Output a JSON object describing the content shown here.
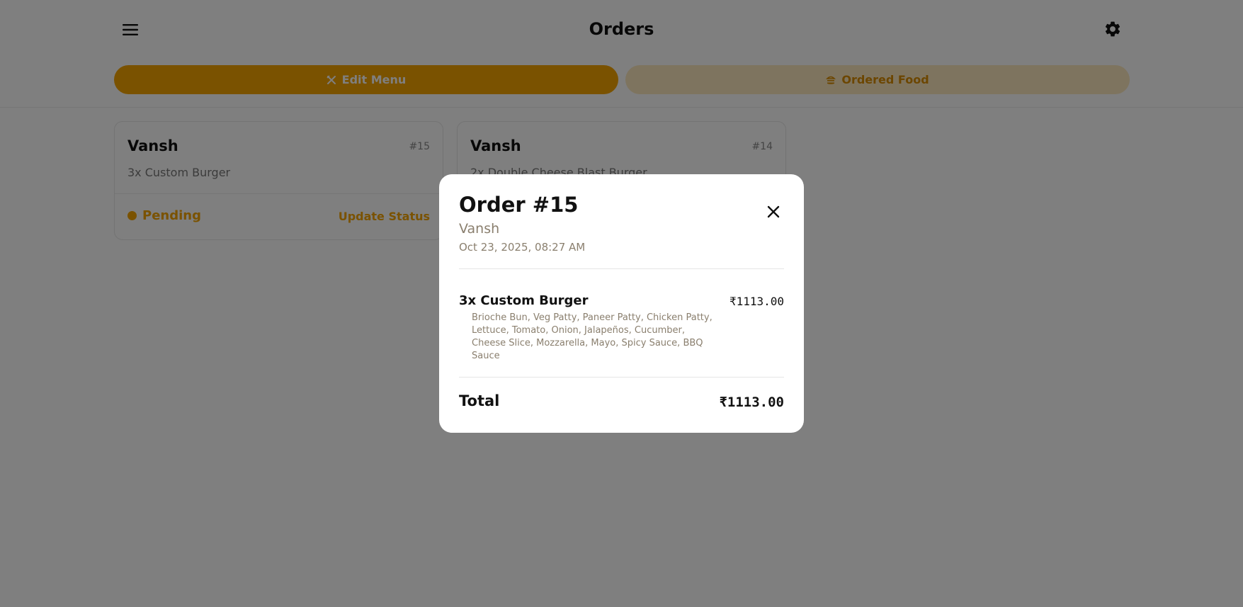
{
  "header": {
    "title": "Orders",
    "menu_icon": "hamburger-icon",
    "settings_icon": "gear-icon"
  },
  "tabs": [
    {
      "label": "Edit Menu",
      "icon": "utensils-icon",
      "active": true
    },
    {
      "label": "Ordered Food",
      "icon": "food-icon",
      "active": false
    }
  ],
  "orders": [
    {
      "customer": "Vansh",
      "number": "#15",
      "items": "3x Custom Burger",
      "status": "Pending",
      "action": "Update Status"
    },
    {
      "customer": "Vansh",
      "number": "#14",
      "items": "2x Double Cheese Blast Burger"
    }
  ],
  "modal": {
    "title": "Order #15",
    "customer": "Vansh",
    "date": "Oct 23, 2025, 08:27 AM",
    "close_icon": "close-icon",
    "items": [
      {
        "name": "3x Custom Burger",
        "price": "₹1113.00",
        "details": "Brioche Bun, Veg Patty, Paneer Patty, Chicken Patty, Lettuce, Tomato, Onion, Jalapeños, Cucumber, Cheese Slice, Mozzarella, Mayo, Spicy Sauce, BBQ Sauce"
      }
    ],
    "total_label": "Total",
    "total_value": "₹1113.00"
  },
  "colors": {
    "accent": "#f5a400",
    "accent_light": "#fde8bf",
    "overlay": "rgba(0,0,0,0.5)"
  }
}
